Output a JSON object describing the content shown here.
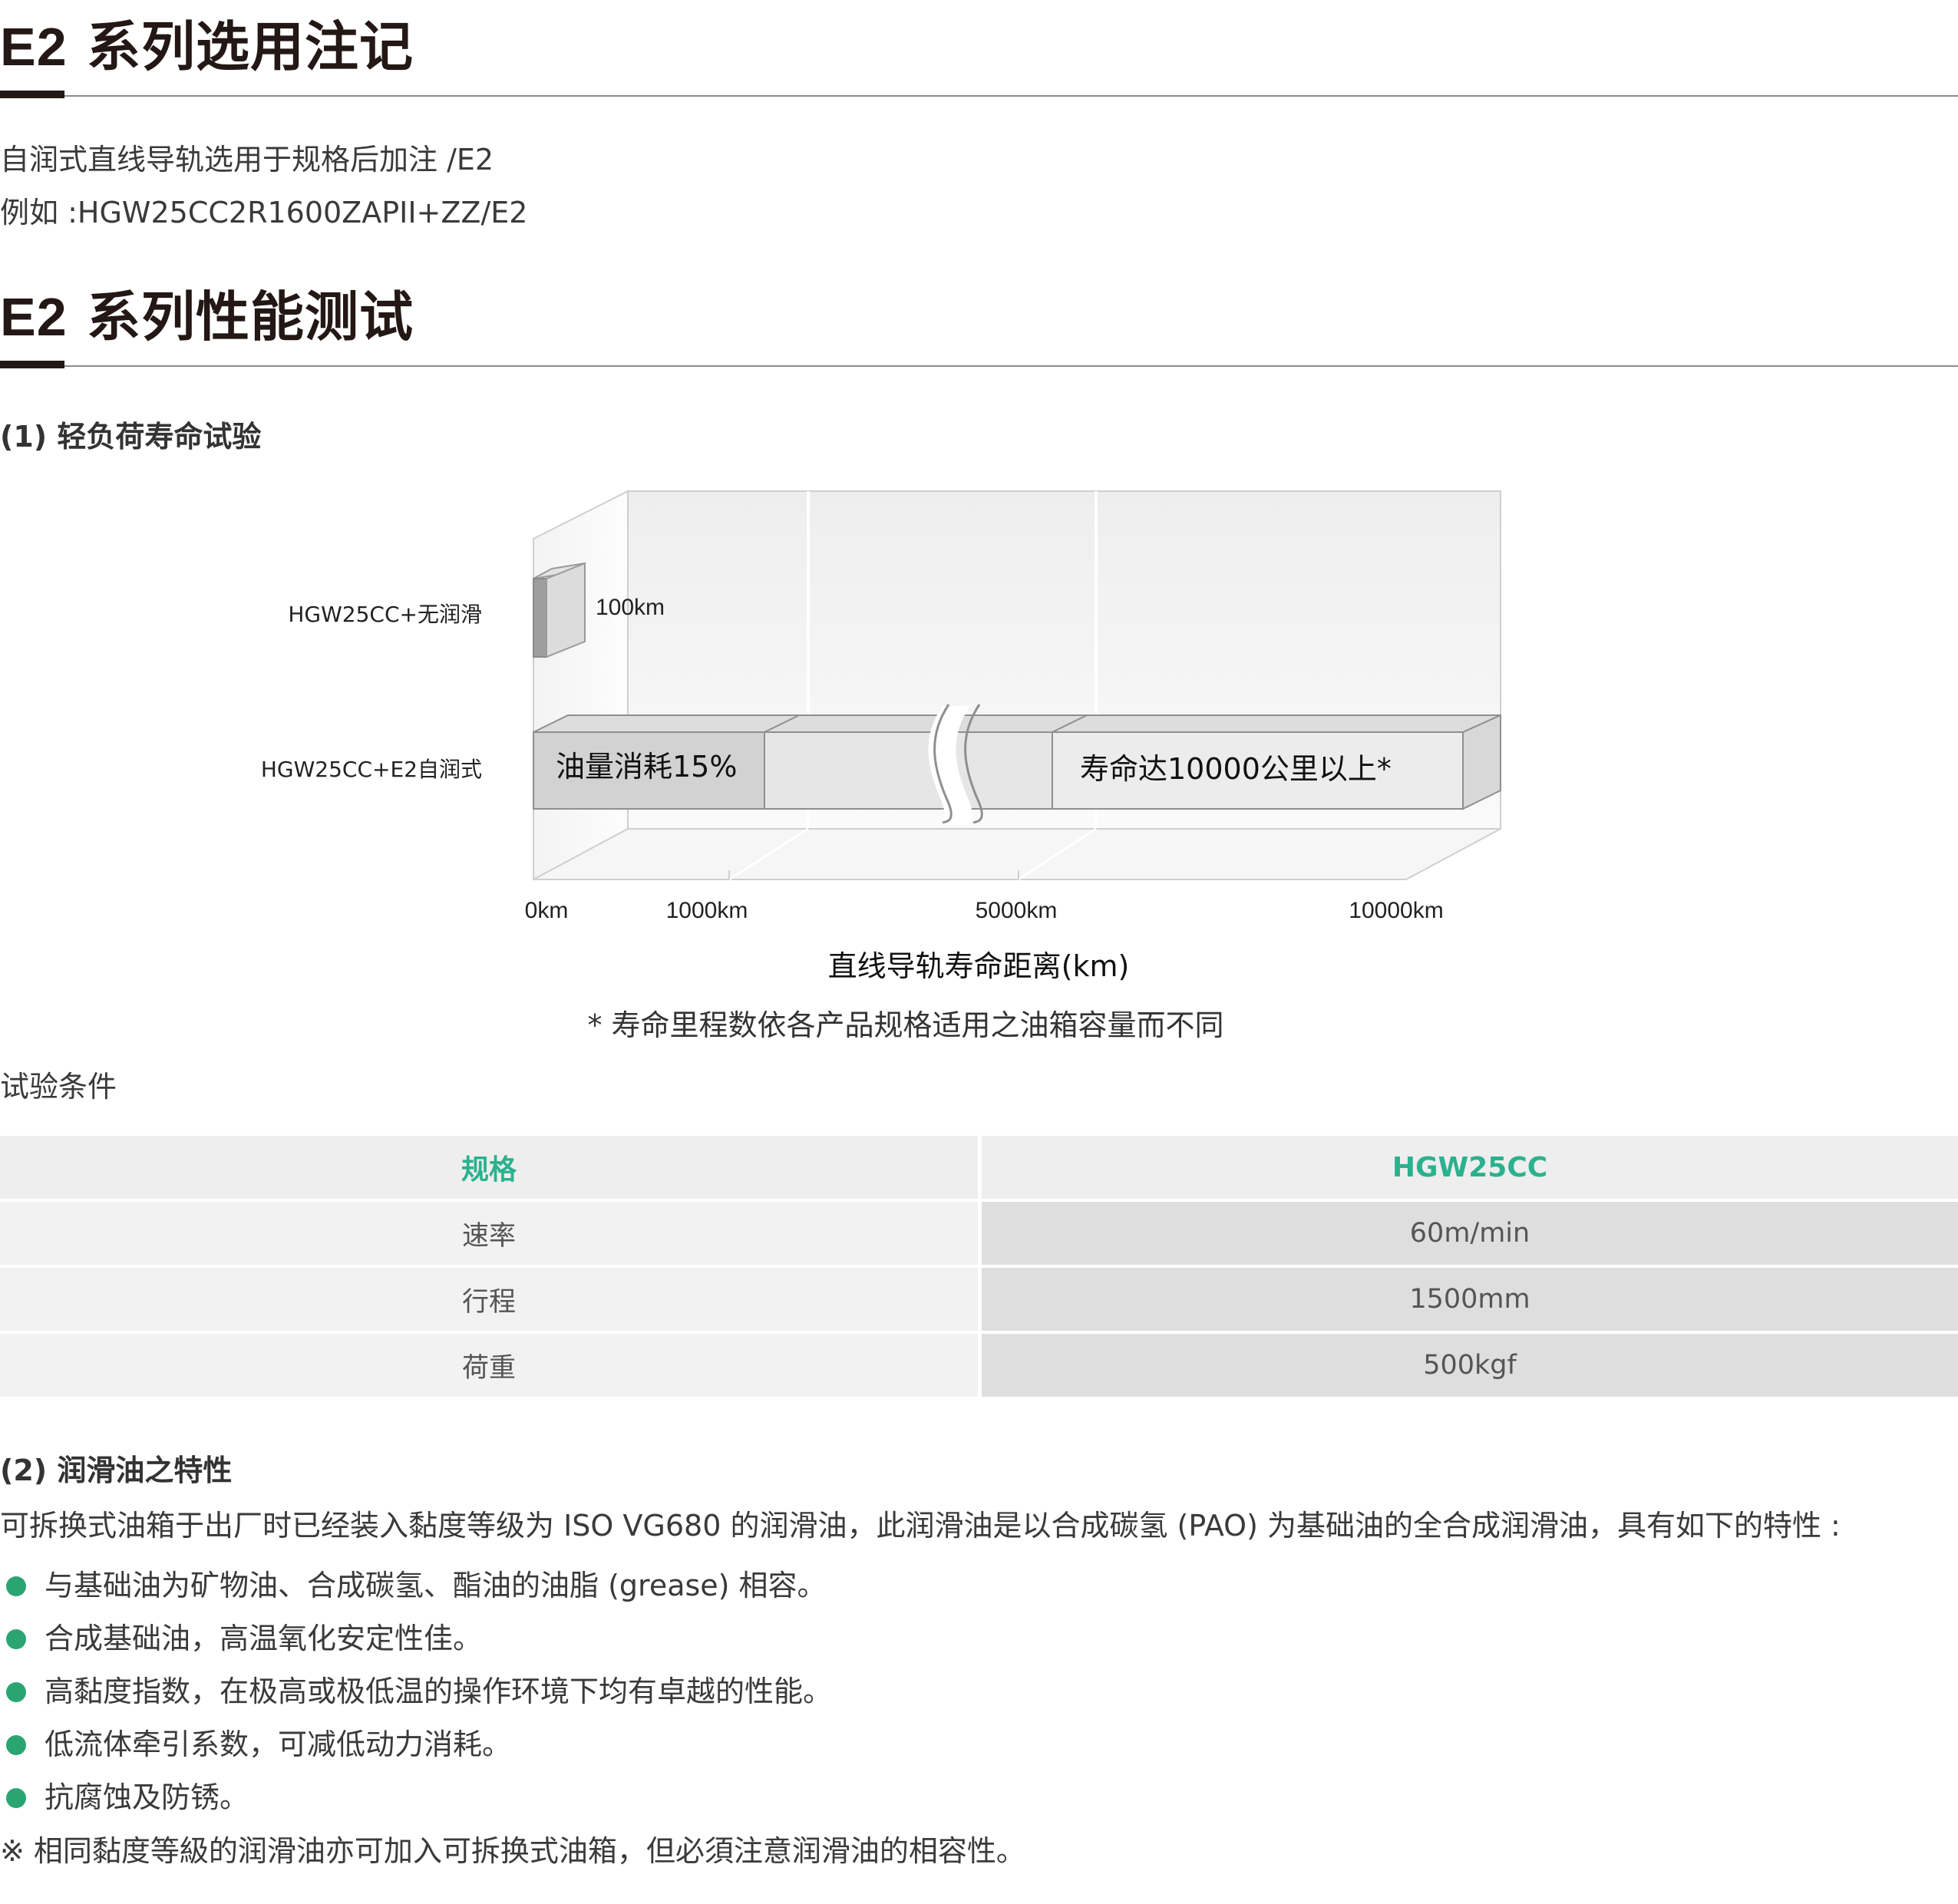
{
  "section1": {
    "title_code": "E2",
    "title_text": "系列选用注记",
    "line1": "自润式直线导轨选用于规格后加注 /E2",
    "line2": "例如 :HGW25CC2R1600ZAPII+ZZ/E2"
  },
  "section2": {
    "title_code": "E2",
    "title_text": "系列性能测试",
    "test1_title": "(1) 轻负荷寿命试验",
    "conditions_label": "试验条件",
    "test2_title": "(2) 润滑油之特性",
    "intro": "可拆换式油箱于出厂时已经装入黏度等级为 ISO VG680 的润滑油，此润滑油是以合成碳氢 (PAO) 为基础油的全合成润滑油，具有如下的特性 :",
    "bullets": [
      "与基础油为矿物油、合成碳氢、酯油的油脂 (grease) 相容。",
      "合成基础油，高温氧化安定性佳。",
      "高黏度指数，在极高或极低温的操作环境下均有卓越的性能。",
      "低流体牵引系数，可减低动力消耗。",
      "抗腐蚀及防锈。"
    ],
    "footnote": "※ 相同黏度等級的润滑油亦可加入可拆换式油箱，但必須注意润滑油的相容性。"
  },
  "chart_data": {
    "type": "bar",
    "orientation": "horizontal",
    "style": "3d",
    "categories": [
      "HGW25CC+无润滑",
      "HGW25CC+E2自润式"
    ],
    "values": [
      100,
      10000
    ],
    "value_labels": [
      "100km",
      ""
    ],
    "segment_labels": [
      "油量消耗15%",
      "寿命达10000公里以上*"
    ],
    "xticks": [
      "0km",
      "1000km",
      "5000km",
      "10000km"
    ],
    "xlabel": "直线导轨寿命距离(km)",
    "axis_break": true,
    "note": "* 寿命里程数依各产品规格适用之油箱容量而不同"
  },
  "table": {
    "header": [
      "规格",
      "HGW25CC"
    ],
    "rows": [
      [
        "速率",
        "60m/min"
      ],
      [
        "行程",
        "1500mm"
      ],
      [
        "荷重",
        "500kgf"
      ]
    ]
  },
  "colors": {
    "accent": "#2bb18d",
    "bullet": "#2aa572",
    "title": "#231815"
  }
}
